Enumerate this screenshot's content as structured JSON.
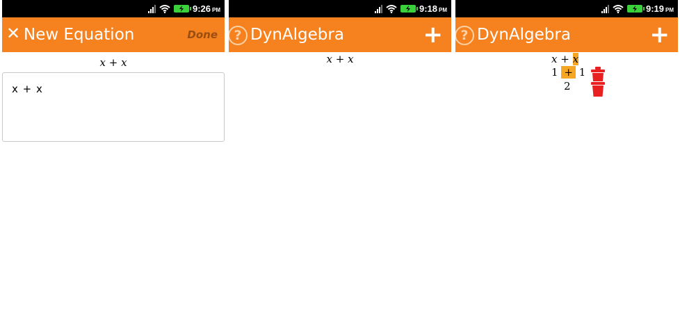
{
  "screens": [
    {
      "status": {
        "time": "9:26",
        "ampm": "PM"
      },
      "appbar": {
        "close_symbol": "✕",
        "title": "New Equation",
        "done_label": "Done"
      },
      "preview": {
        "left": "x",
        "op": "+",
        "right": "x"
      },
      "editor": {
        "value": "x + x"
      }
    },
    {
      "status": {
        "time": "9:18",
        "ampm": "PM"
      },
      "appbar": {
        "help_symbol": "?",
        "title": "DynAlgebra",
        "plus_symbol": "+"
      },
      "equation": {
        "left": "x",
        "op": "+",
        "right": "x"
      }
    },
    {
      "status": {
        "time": "9:19",
        "ampm": "PM"
      },
      "appbar": {
        "help_symbol": "?",
        "title": "DynAlgebra",
        "plus_symbol": "+"
      },
      "tree": {
        "row1": {
          "left": "x",
          "op": "+",
          "right": "x"
        },
        "row2": {
          "left": "1",
          "op": "+",
          "right": "1"
        },
        "row3": {
          "value": "2"
        }
      }
    }
  ],
  "colors": {
    "appbar": "#f5821f",
    "highlight": "#f5a623",
    "trash": "#e8201f",
    "battery": "#3ad13a",
    "done": "#9a4e10"
  },
  "icons": [
    "signal-icon",
    "wifi-icon",
    "battery-charging-icon",
    "close-icon",
    "help-icon",
    "plus-icon",
    "trash-icon"
  ]
}
